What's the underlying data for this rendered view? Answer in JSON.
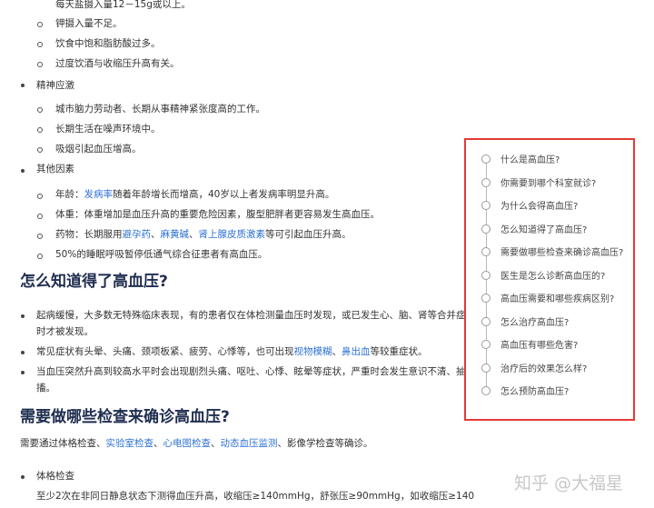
{
  "article": {
    "top_sub_items": [
      "每天盐摄入量12－15g或以上。",
      "钾摄入量不足。",
      "饮食中饱和脂肪酸过多。",
      "过度饮酒与收缩压升高有关。"
    ],
    "mental_stress": {
      "label": "精神应激",
      "items": [
        "城市脑力劳动者、长期从事精神紧张度高的工作。",
        "长期生活在噪声环境中。",
        "吸烟引起血压增高。"
      ]
    },
    "other_factors": {
      "label": "其他因素",
      "age": {
        "prefix": "年龄：",
        "link": "发病率",
        "suffix": "随着年龄增长而增高，40岁以上者发病率明显升高。"
      },
      "weight": "体重：体重增加是血压升高的重要危险因素，腹型肥胖者更容易发生高血压。",
      "drug": {
        "prefix": "药物：长期服用",
        "link1": "避孕药",
        "sep1": "、",
        "link2": "麻黄碱",
        "sep2": "、",
        "link3": "肾上腺皮质激素",
        "suffix": "等可引起血压升高。"
      },
      "osa": "50%的睡眠呼吸暂停低通气综合征患者有高血压。"
    },
    "section_diagnose": {
      "title": "怎么知道得了高血压?",
      "p1_line1": "起病缓慢，大多数无特殊临床表现，有的患者仅在体检测量血压时发现，或已发生心、脑、肾等合并症",
      "p1_line2": "时才被发现。",
      "p2": {
        "prefix": "常见症状有头晕、头痛、颈项板紧、疲劳、心悸等，也可出现",
        "link1": "视物模糊",
        "sep": "、",
        "link2": "鼻出血",
        "suffix": "等较重症状。"
      },
      "p3_line1": "当血压突然升高到较高水平时会出现剧烈头痛、呕吐、心悸、眩晕等症状，严重时会发生意识不清、抽",
      "p3_line2": "搐。"
    },
    "section_exams": {
      "title": "需要做哪些检查来确诊高血压?",
      "intro": {
        "prefix": "需要通过体格检查、",
        "link1": "实验室检查",
        "sep1": "、",
        "link2": "心电图检查",
        "sep2": "、",
        "link3": "动态血压监测",
        "suffix": "、影像学检查等确诊。"
      },
      "physical_label": "体格检查",
      "physical_text": "至少2次在非同日静息状态下测得血压升高，收缩压≥140mmHg，舒张压≥90mmHg，如收缩压≥140"
    }
  },
  "toc": {
    "items": [
      "什么是高血压?",
      "你需要到哪个科室就诊?",
      "为什么会得高血压?",
      "怎么知道得了高血压?",
      "需要做哪些检查来确诊高血压?",
      "医生是怎么诊断高血压的?",
      "高血压需要和哪些疾病区别?",
      "怎么治疗高血压?",
      "高血压有哪些危害?",
      "治疗后的效果怎么样?",
      "怎么预防高血压?"
    ]
  },
  "watermark": "知乎 @大福星",
  "colors": {
    "link": "#2e72d2",
    "heading": "#1f2d4f",
    "toc_border": "#e53935"
  }
}
